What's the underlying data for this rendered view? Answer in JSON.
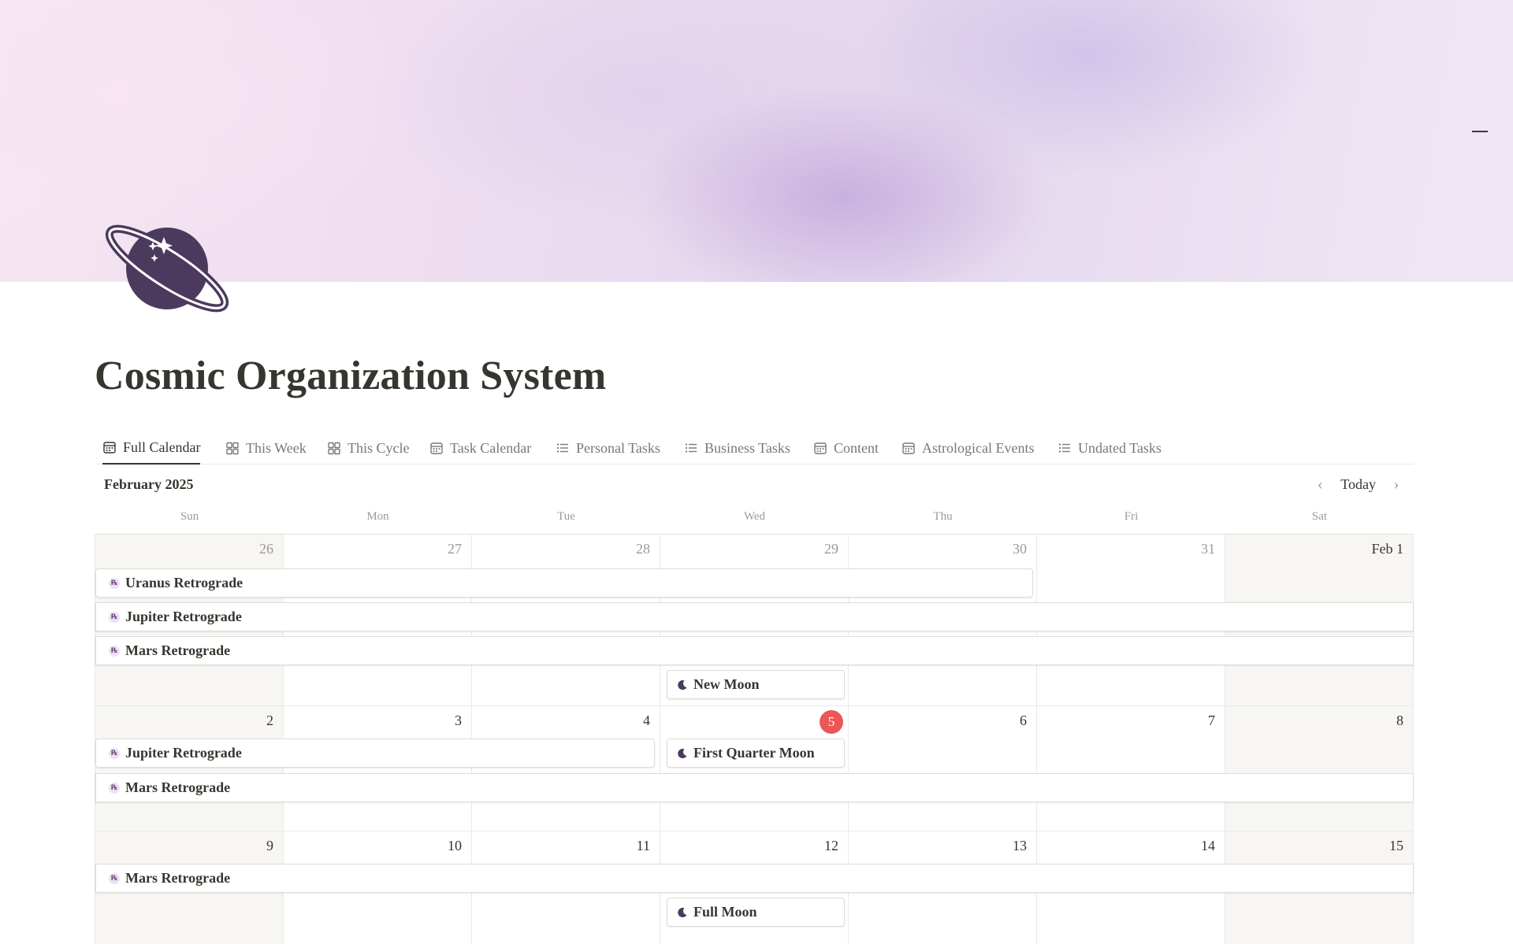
{
  "page": {
    "title": "Cosmic Organization System",
    "icon": "ringed-planet-icon",
    "accent_color": "#4b3a5e",
    "today_marker_color": "#eb5757"
  },
  "tabs": [
    {
      "label": "Full Calendar",
      "icon": "calendar-icon",
      "active": true
    },
    {
      "label": "This Week",
      "icon": "gallery-icon"
    },
    {
      "label": "This Cycle",
      "icon": "gallery-icon"
    },
    {
      "label": "Task Calendar",
      "icon": "calendar-icon"
    },
    {
      "label": "Personal Tasks",
      "icon": "list-icon"
    },
    {
      "label": "Business Tasks",
      "icon": "list-icon"
    },
    {
      "label": "Content",
      "icon": "calendar-icon"
    },
    {
      "label": "Astrological Events",
      "icon": "calendar-icon"
    },
    {
      "label": "Undated Tasks",
      "icon": "list-icon"
    }
  ],
  "calendar": {
    "month_label": "February 2025",
    "today_label": "Today",
    "weekdays": [
      "Sun",
      "Mon",
      "Tue",
      "Wed",
      "Thu",
      "Fri",
      "Sat"
    ],
    "weeks": [
      [
        "26",
        "27",
        "28",
        "29",
        "30",
        "31",
        "Feb 1"
      ],
      [
        "2",
        "3",
        "4",
        "5",
        "6",
        "7",
        "8"
      ],
      [
        "9",
        "10",
        "11",
        "12",
        "13",
        "14",
        "15"
      ]
    ],
    "today_date": "5",
    "events": {
      "uranus_retrograde": "Uranus Retrograde",
      "jupiter_retrograde": "Jupiter Retrograde",
      "mars_retrograde": "Mars Retrograde",
      "new_moon": "New Moon",
      "first_quarter_moon": "First Quarter Moon",
      "full_moon": "Full Moon"
    },
    "retrograde_badge": "℞"
  }
}
